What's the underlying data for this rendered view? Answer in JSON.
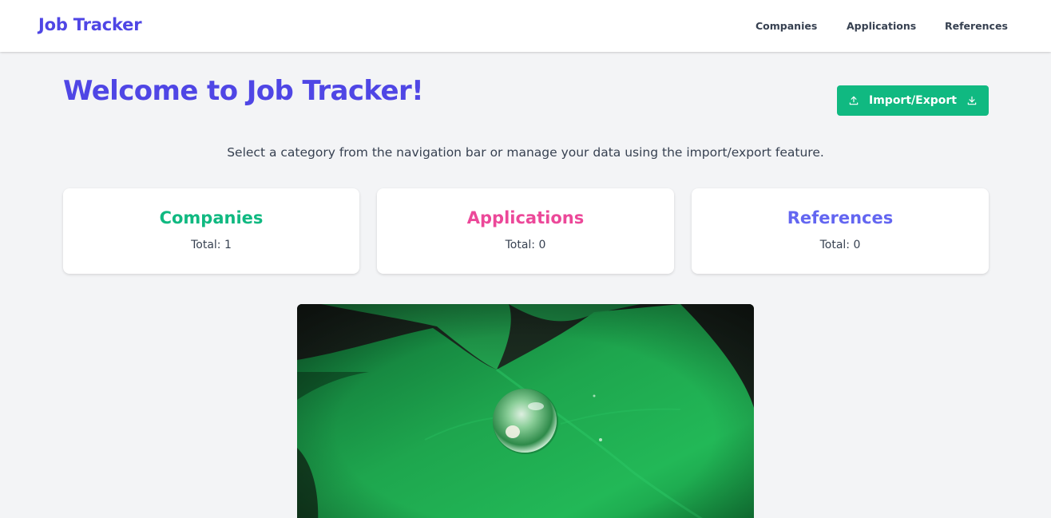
{
  "app": {
    "title": "Job Tracker"
  },
  "nav": {
    "items": [
      {
        "label": "Companies"
      },
      {
        "label": "Applications"
      },
      {
        "label": "References"
      }
    ]
  },
  "main": {
    "heading": "Welcome to Job Tracker!",
    "import_export": {
      "label": "Import/Export",
      "left_icon": "upload-icon",
      "right_icon": "download-icon",
      "color": "#10b981"
    },
    "subtitle": "Select a category from the navigation bar or manage your data using the import/export feature.",
    "cards": [
      {
        "title": "Companies",
        "total": "Total: 1",
        "color": "#10b981"
      },
      {
        "title": "Applications",
        "total": "Total: 0",
        "color": "#ec4899"
      },
      {
        "title": "References",
        "total": "Total: 0",
        "color": "#6366f1"
      }
    ],
    "hero_image": {
      "subject": "water droplet on green leaf"
    }
  },
  "colors": {
    "brand": "#4f46e5",
    "background": "#f3f4f6",
    "text": "#374151"
  }
}
